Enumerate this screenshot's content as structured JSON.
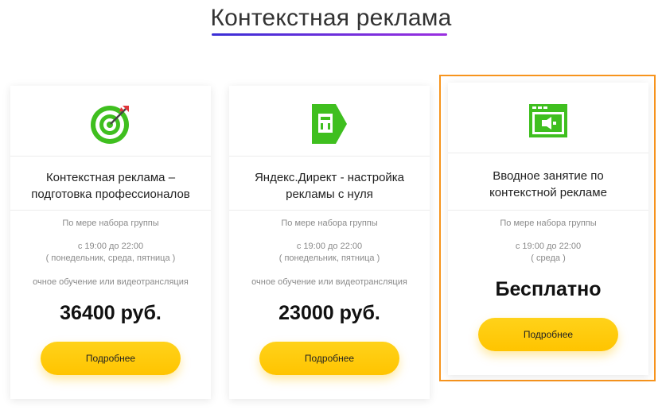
{
  "section_title": "Контекстная реклама",
  "colors": {
    "accent": "#ffc400",
    "highlight_border": "#f7941d",
    "icon_green": "#3fbf1f",
    "underline_from": "#3a2fd6",
    "underline_to": "#9b2fe0"
  },
  "cards": [
    {
      "icon": "target-icon",
      "title_line1": "Контекстная реклама –",
      "title_line2": "подготовка профессионалов",
      "schedule_note": "По мере набора группы",
      "time": "с 19:00 до 22:00",
      "days": "( понедельник, среда, пятница )",
      "format": "очное обучение или видеотрансляция",
      "price": "36400 руб.",
      "button_label": "Подробнее"
    },
    {
      "icon": "yandex-direct-icon",
      "title_line1": "Яндекс.Директ - настройка",
      "title_line2": "рекламы с нуля",
      "schedule_note": "По мере набора группы",
      "time": "с 19:00 до 22:00",
      "days": "( понедельник, пятница )",
      "format": "очное обучение или видеотрансляция",
      "price": "23000 руб.",
      "button_label": "Подробнее"
    },
    {
      "icon": "browser-ad-icon",
      "title_line1": "Вводное занятие по",
      "title_line2": "контекстной рекламе",
      "schedule_note": "По мере набора группы",
      "time": "с 19:00 до 22:00",
      "days": "( среда )",
      "price": "Бесплатно",
      "button_label": "Подробнее"
    }
  ]
}
